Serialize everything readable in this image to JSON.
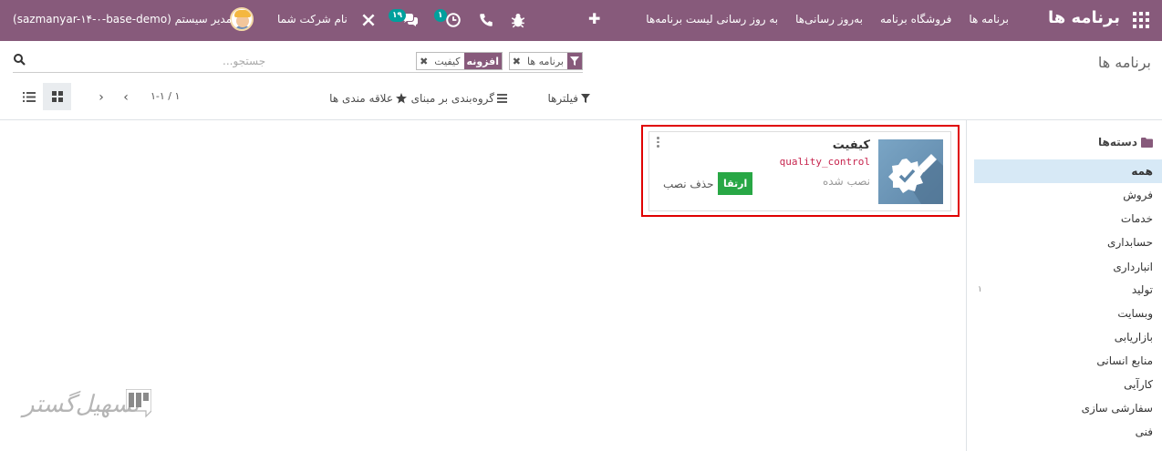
{
  "navbar": {
    "brand": "برنامه ها",
    "menu": [
      "برنامه ها",
      "فروشگاه برنامه",
      "به‌روز رسانی‌ها",
      "به روز رسانی لیست برنامه‌ها"
    ],
    "company": "نام شرکت شما",
    "user": "مدیر سیستم (sazmanyar-۱۴-۰-base-demo)",
    "badge_activity": "۱",
    "badge_messages": "۱۹",
    "icons": [
      "apps-grid-icon",
      "plus-icon",
      "bug-icon",
      "phone-icon",
      "clock-icon",
      "chat-icon",
      "tools-icon"
    ]
  },
  "control_panel": {
    "title": "برنامه ها",
    "facets": [
      {
        "key": "filter",
        "value": "برنامه ها"
      },
      {
        "key": "افزونه",
        "value": "کیفیت"
      }
    ],
    "search_placeholder": "جستجو...",
    "filters_label": "فیلترها",
    "groupby_label": "گروه‌بندی بر مبنای",
    "favorites_label": "علاقه مندی ها",
    "pager_value": "۱-۱ / ۱"
  },
  "side_panel": {
    "header": "دسته‌ها",
    "items": [
      {
        "label": "همه",
        "active": true
      },
      {
        "label": "فروش"
      },
      {
        "label": "خدمات"
      },
      {
        "label": "حسابداری"
      },
      {
        "label": "انبارداری"
      },
      {
        "label": "تولید",
        "count": "۱"
      },
      {
        "label": "وبسایت"
      },
      {
        "label": "بازاریابی"
      },
      {
        "label": "منابع انسانی"
      },
      {
        "label": "کارآیی"
      },
      {
        "label": "سفارشی سازی"
      },
      {
        "label": "فنی"
      }
    ]
  },
  "card": {
    "name": "کیفیت",
    "technical_name": "quality_control",
    "status": "نصب شده",
    "upgrade_label": "ارتقا",
    "uninstall_label": "حذف نصب"
  },
  "watermark": {
    "text": "تسهیل‌گستر"
  },
  "colors": {
    "brand": "#875a7b",
    "badge": "#00a09d",
    "upgrade": "#28a745",
    "highlight": "#e00000",
    "active_side": "#d7e9f6"
  }
}
